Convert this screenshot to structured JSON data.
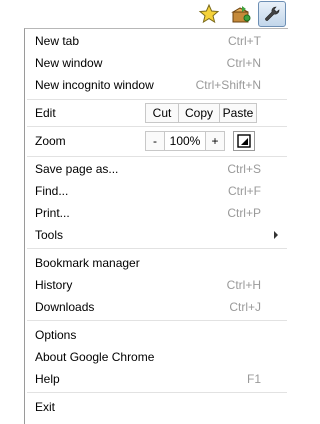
{
  "toolbar": {
    "icons": [
      "star-icon",
      "extension-icon",
      "wrench-icon"
    ]
  },
  "menu": {
    "new_tab": {
      "label": "New tab",
      "shortcut": "Ctrl+T"
    },
    "new_window": {
      "label": "New window",
      "shortcut": "Ctrl+N"
    },
    "new_incognito": {
      "label": "New incognito window",
      "shortcut": "Ctrl+Shift+N"
    },
    "edit": {
      "label": "Edit",
      "cut": "Cut",
      "copy": "Copy",
      "paste": "Paste"
    },
    "zoom": {
      "label": "Zoom",
      "minus": "-",
      "level": "100%",
      "plus": "+"
    },
    "save_page": {
      "label": "Save page as...",
      "shortcut": "Ctrl+S"
    },
    "find": {
      "label": "Find...",
      "shortcut": "Ctrl+F"
    },
    "print": {
      "label": "Print...",
      "shortcut": "Ctrl+P"
    },
    "tools": {
      "label": "Tools"
    },
    "bookmark_manager": {
      "label": "Bookmark manager"
    },
    "history": {
      "label": "History",
      "shortcut": "Ctrl+H"
    },
    "downloads": {
      "label": "Downloads",
      "shortcut": "Ctrl+J"
    },
    "options": {
      "label": "Options"
    },
    "about": {
      "label": "About Google Chrome"
    },
    "help": {
      "label": "Help",
      "shortcut": "F1"
    },
    "exit": {
      "label": "Exit"
    }
  },
  "colors": {
    "shortcut_text": "#9a9a9a",
    "separator": "#e2e2e2",
    "wrench_highlight": "#c2d6ea"
  }
}
